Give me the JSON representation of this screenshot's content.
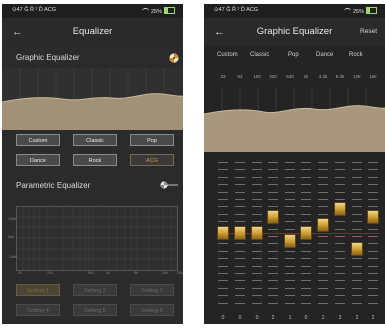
{
  "status_bar": {
    "left_text": "⊙47 Ĝ R̂ ¹ D̂ ACG",
    "battery_text": "25%"
  },
  "left": {
    "title": "Equalizer",
    "graphic_eq_label": "Graphic Equalizer",
    "presets": [
      "Custom",
      "Classic",
      "Pop",
      "Dance",
      "Rock",
      "ACG"
    ],
    "active_preset": "ACG",
    "parametric_eq_label": "Parametric Equalizer",
    "graph_y_labels": [
      "10db",
      "0db",
      "-10db"
    ],
    "graph_x_labels": [
      "20",
      "100",
      "500",
      "1k",
      "5k",
      "10k",
      "20k"
    ],
    "settings": [
      "Setting 1",
      "Setting 2",
      "Setting 3",
      "Setting 4",
      "Setting 5",
      "Setting 6"
    ]
  },
  "right": {
    "title": "Graphic Equalizer",
    "reset_label": "Reset",
    "presets": [
      "Custom",
      "Classic",
      "Pop",
      "Dance",
      "Rock"
    ],
    "bands": [
      {
        "freq": "33",
        "gain": 0
      },
      {
        "freq": "63",
        "gain": 0
      },
      {
        "freq": "100",
        "gain": 0
      },
      {
        "freq": "320",
        "gain": 2
      },
      {
        "freq": "630",
        "gain": -1
      },
      {
        "freq": "1k",
        "gain": 0
      },
      {
        "freq": "3.2k",
        "gain": 1
      },
      {
        "freq": "6.3k",
        "gain": 3
      },
      {
        "freq": "10k",
        "gain": -2
      },
      {
        "freq": "16k",
        "gain": 2
      }
    ],
    "gain_labels": [
      "0",
      "0",
      "0",
      "2",
      "1",
      "0",
      "1",
      "3",
      "2",
      "2"
    ]
  },
  "colors": {
    "accent_gold": "#c8a046",
    "curve_fill": "#a8977c",
    "zero_line": "#7a2a2a"
  }
}
